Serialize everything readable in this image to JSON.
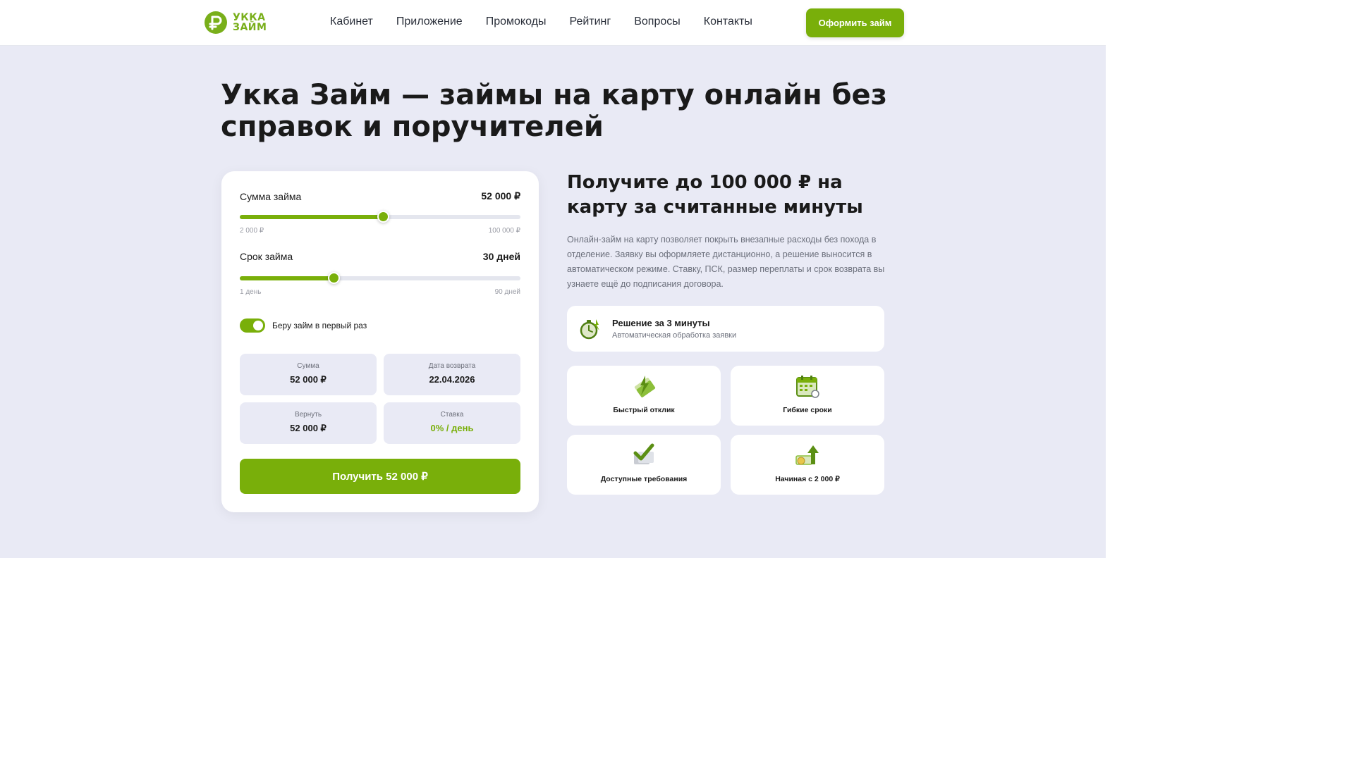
{
  "header": {
    "logo_line1": "УККА",
    "logo_line2": "ЗАЙМ",
    "nav": [
      "Кабинет",
      "Приложение",
      "Промокоды",
      "Рейтинг",
      "Вопросы",
      "Контакты"
    ],
    "cta_label": "Оформить займ"
  },
  "hero": {
    "title": "Укка Займ — займы на карту онлайн без справок и поручителей"
  },
  "calculator": {
    "amount_label": "Сумма займа",
    "amount_value": "52 000 ₽",
    "amount_min": "2 000 ₽",
    "amount_max": "100 000 ₽",
    "amount_fraction": 0.51,
    "term_label": "Срок займа",
    "term_value": "30 дней",
    "term_min": "1 день",
    "term_max": "90 дней",
    "term_fraction": 0.334,
    "first_time_label": "Беру займ в первый раз",
    "first_time_on": true,
    "stats": [
      {
        "label": "Сумма",
        "value": "52 000 ₽"
      },
      {
        "label": "Дата возврата",
        "value": "22.04.2026"
      },
      {
        "label": "Вернуть",
        "value": "52 000 ₽"
      },
      {
        "label": "Ставка",
        "value": "0% / день"
      }
    ],
    "submit_label": "Получить 52 000 ₽"
  },
  "info": {
    "title": "Получите до 100 000 ₽ на карту за считанные минуты",
    "description": "Онлайн-займ на карту позволяет покрыть внезапные расходы без похода в отделение. Заявку вы оформляете дистанционно, а решение выносится в автоматическом режиме. Ставку, ПСК, размер переплаты и срок возврата вы узнаете ещё до подписания договора.",
    "feature_main": {
      "title": "Решение за 3 минуты",
      "subtitle": "Автоматическая обработка заявки",
      "icon": "stopwatch-icon"
    },
    "features": [
      {
        "label": "Быстрый отклик",
        "icon": "lightning-icon"
      },
      {
        "label": "Гибкие сроки",
        "icon": "calendar-icon"
      },
      {
        "label": "Доступные требования",
        "icon": "checkmark-docs-icon"
      },
      {
        "label": "Начиная с 2 000 ₽",
        "icon": "money-growth-icon"
      }
    ]
  },
  "colors": {
    "accent": "#79af0a",
    "hero_bg": "#e9eaf5",
    "text": "#1a1a1a"
  }
}
